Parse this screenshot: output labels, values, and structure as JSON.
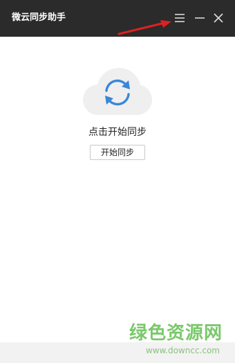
{
  "window": {
    "title": "微云同步助手",
    "menu_icon": "menu-icon",
    "minimize_icon": "minimize-icon",
    "close_icon": "close-icon"
  },
  "main": {
    "icon": "sync-cloud-icon",
    "prompt": "点击开始同步",
    "start_button_label": "开始同步"
  },
  "watermark": {
    "logo_text": "绿色资源网",
    "url_text": "www.downcc.com"
  },
  "colors": {
    "titlebar": "#2b2b2b",
    "cloud": "#efefef",
    "sync_accent": "#3a86d8",
    "annotation_arrow": "#e02020",
    "watermark": "#79c86a"
  }
}
